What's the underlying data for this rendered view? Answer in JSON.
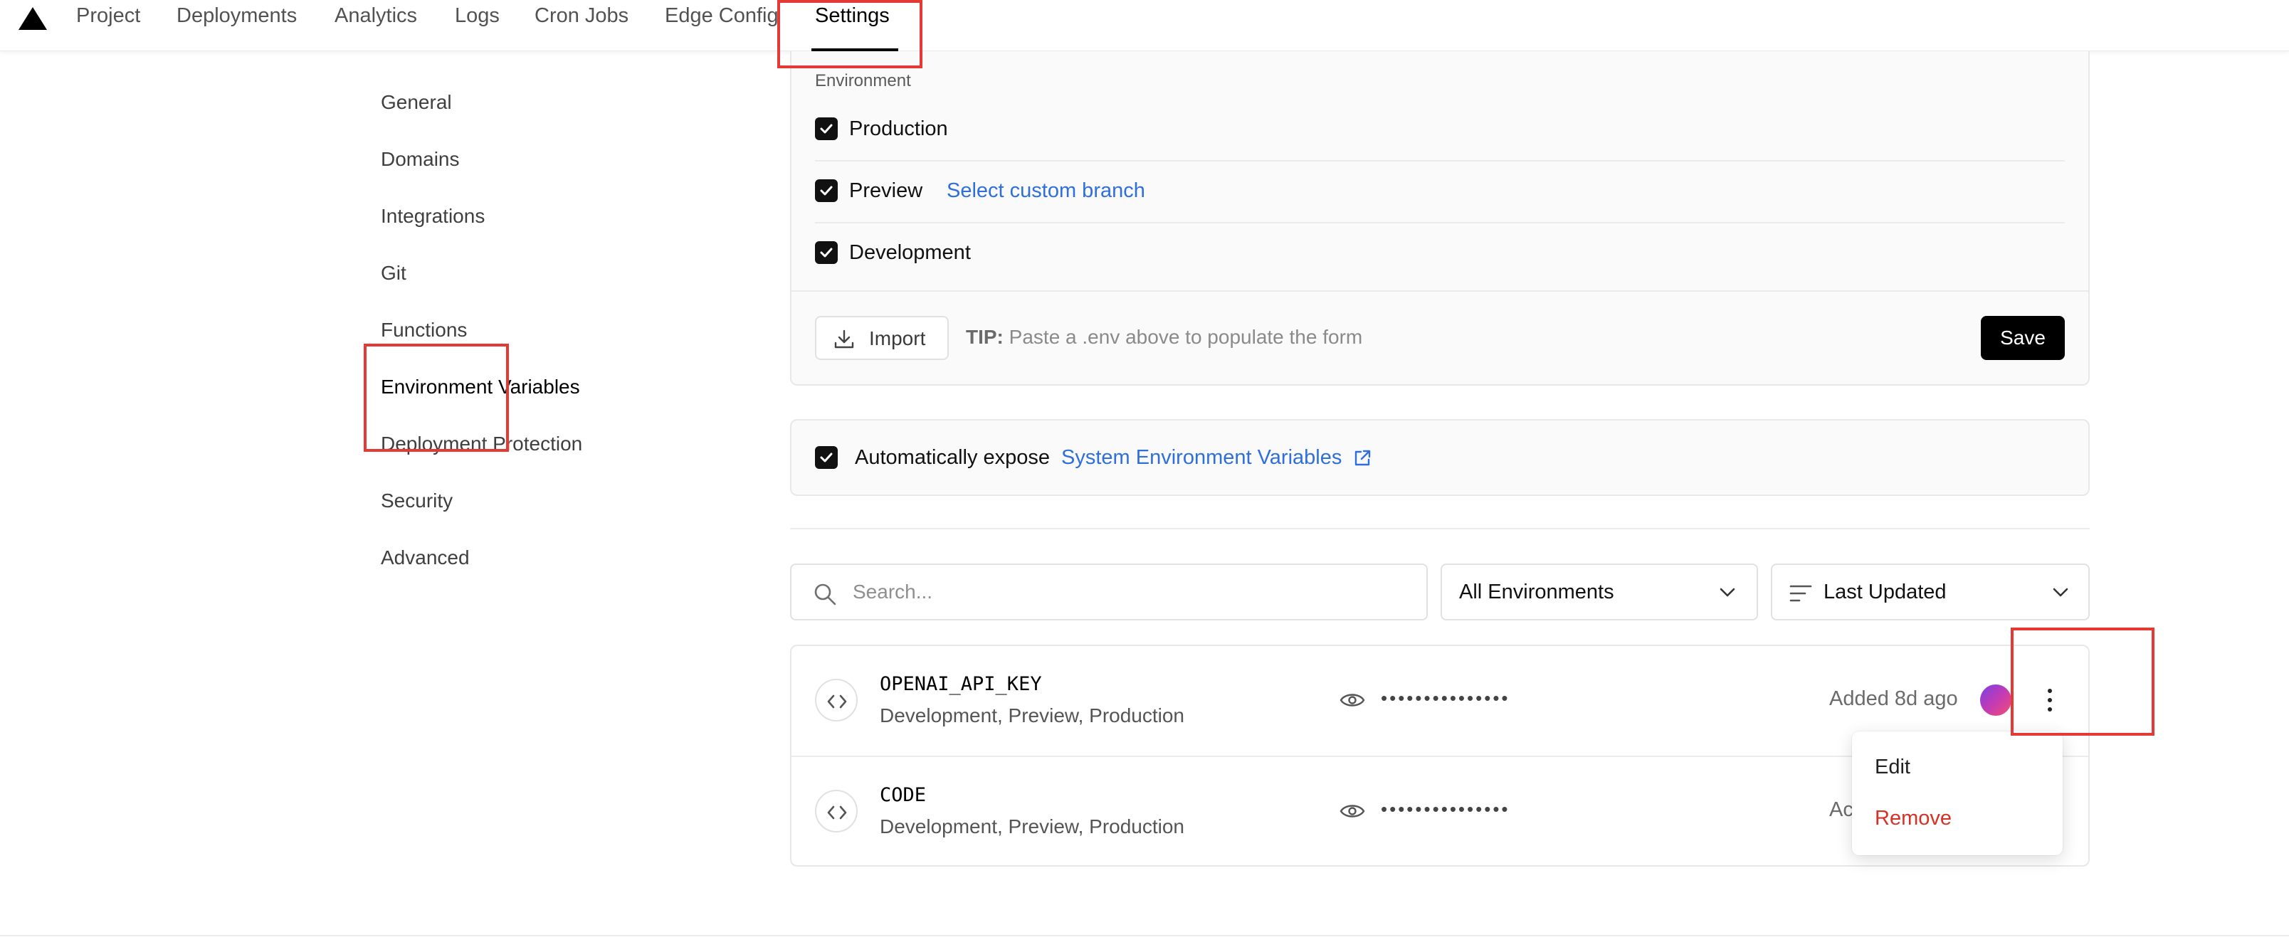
{
  "topnav": {
    "items": [
      "Project",
      "Deployments",
      "Analytics",
      "Logs",
      "Cron Jobs",
      "Edge Config",
      "Settings"
    ],
    "active": "Settings"
  },
  "sidebar": {
    "items": [
      "General",
      "Domains",
      "Integrations",
      "Git",
      "Functions",
      "Environment Variables",
      "Deployment Protection",
      "Security",
      "Advanced"
    ],
    "active": "Environment Variables"
  },
  "environment_panel": {
    "label": "Environment",
    "options": [
      {
        "label": "Production",
        "checked": true
      },
      {
        "label": "Preview",
        "checked": true,
        "link": "Select custom branch"
      },
      {
        "label": "Development",
        "checked": true
      }
    ],
    "import_label": "Import",
    "tip_prefix": "TIP:",
    "tip_text": "Paste a .env above to populate the form",
    "save_label": "Save"
  },
  "system_vars": {
    "checked": true,
    "text": "Automatically expose",
    "link": "System Environment Variables"
  },
  "filters": {
    "search_placeholder": "Search...",
    "environment_select": "All Environments",
    "sort_select": "Last Updated"
  },
  "variables": [
    {
      "name": "OPENAI_API_KEY",
      "environments": "Development, Preview, Production",
      "masked_value": "•••••••••••••••",
      "added": "Added 8d ago"
    },
    {
      "name": "CODE",
      "environments": "Development, Preview, Production",
      "masked_value": "•••••••••••••••",
      "added": "Ac"
    }
  ],
  "row_menu": {
    "edit": "Edit",
    "remove": "Remove"
  },
  "colors": {
    "link": "#2f6fdb",
    "danger": "#d93025",
    "highlight": "#e53935",
    "primary": "#000000"
  }
}
